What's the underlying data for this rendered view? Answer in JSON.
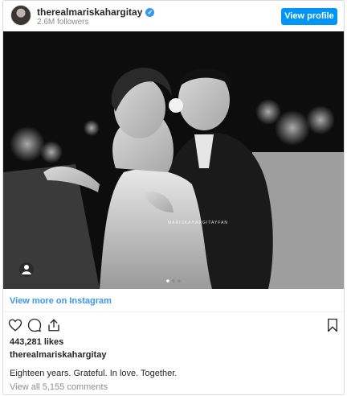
{
  "header": {
    "username": "therealmariskahargitay",
    "followers": "2.6M followers",
    "view_profile_label": "View profile",
    "verified_icon": "check-icon"
  },
  "photo": {
    "watermark": "MARISKAHARGITAYFAN",
    "carousel_dots": 3,
    "active_dot": 0
  },
  "links": {
    "view_more": "View more on Instagram"
  },
  "actions": {
    "icons": [
      "heart-icon",
      "comment-icon",
      "share-icon",
      "bookmark-icon"
    ]
  },
  "post": {
    "likes": "443,281 likes",
    "caption_user": "therealmariskahargitay",
    "caption": "Eighteen years. Grateful. In love. Together.",
    "comments_link": "View all 5,155 comments"
  },
  "colors": {
    "accent": "#3897f0",
    "button": "#0095f6",
    "text": "#262626",
    "muted": "#8e8e8e"
  }
}
